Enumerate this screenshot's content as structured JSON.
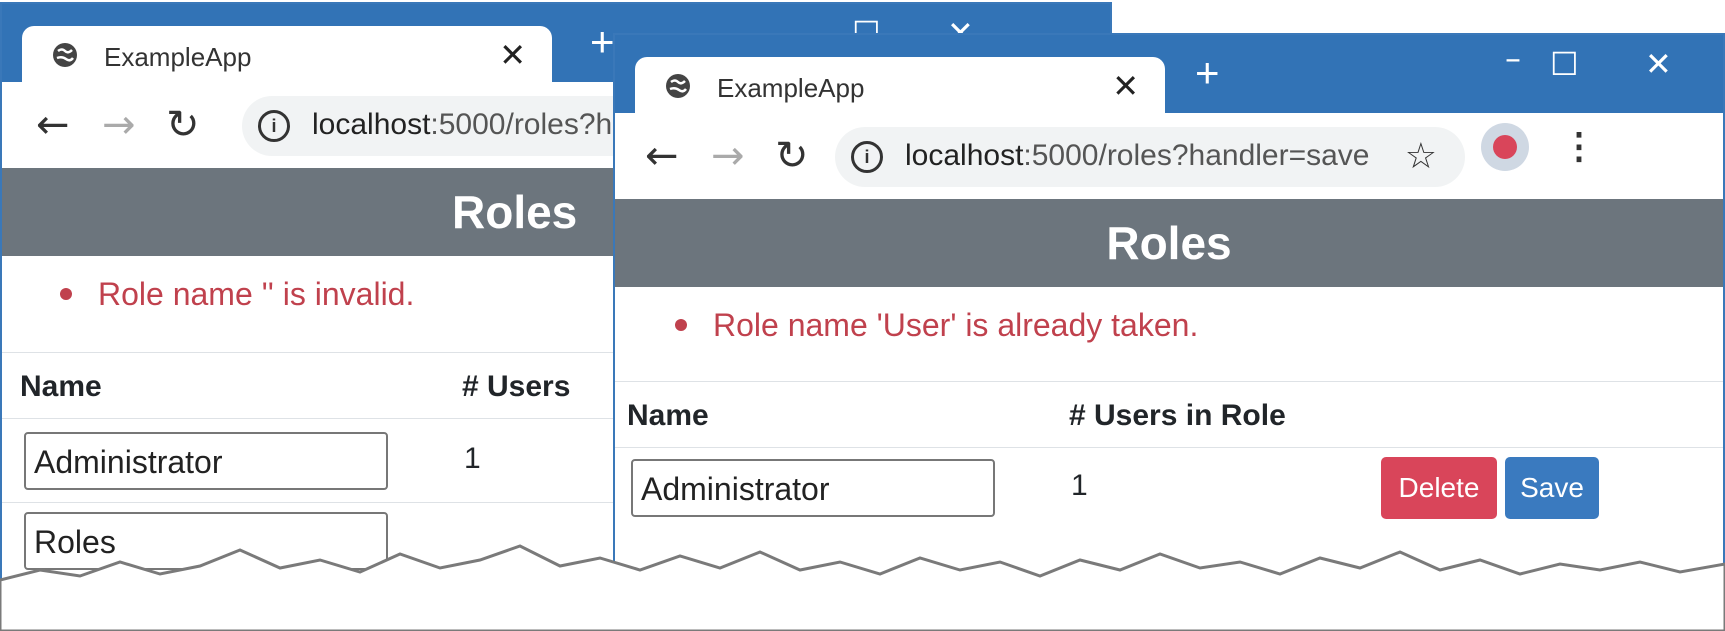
{
  "back_window": {
    "tab_title": "ExampleApp",
    "url_host": "localhost",
    "url_rest": ":5000/roles?h",
    "page_heading": "Roles",
    "error": "Role name '' is invalid.",
    "col_name": "Name",
    "col_users": "# Users",
    "rows": [
      {
        "name": "Administrator",
        "users": "1"
      },
      {
        "name": "Roles",
        "users": ""
      }
    ]
  },
  "front_window": {
    "tab_title": "ExampleApp",
    "url_host": "localhost",
    "url_rest": ":5000/roles?handler=save",
    "page_heading": "Roles",
    "error": "Role name 'User' is already taken.",
    "col_name": "Name",
    "col_users": "# Users in Role",
    "rows": [
      {
        "name": "Administrator",
        "users": "1",
        "delete_label": "Delete",
        "save_label": "Save"
      }
    ]
  },
  "colors": {
    "titlebar": "#3273b6",
    "header": "#6c757d",
    "error": "#c0414d",
    "delete": "#d9455a",
    "save": "#3a7abf"
  },
  "icons": [
    "globe-icon",
    "close-icon",
    "new-tab-icon",
    "back-icon",
    "forward-icon",
    "reload-icon",
    "info-icon",
    "bookmark-star-icon",
    "profile-avatar-icon",
    "menu-kebab-icon",
    "minimize-icon",
    "maximize-icon",
    "window-close-icon"
  ]
}
